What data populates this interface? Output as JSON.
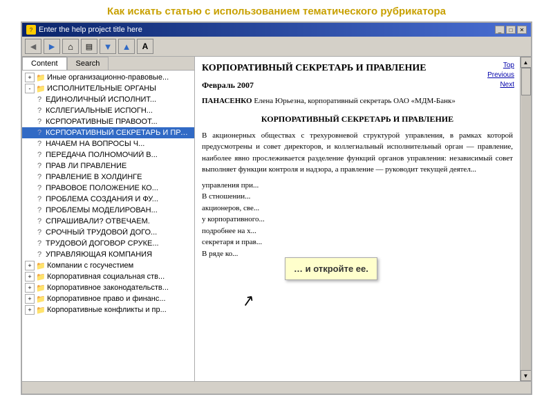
{
  "page": {
    "title": "Как искать статью с использованием тематического рубрикатора"
  },
  "window": {
    "title": "Enter the help project title here",
    "controls": {
      "minimize": "_",
      "maximize": "□",
      "close": "✕"
    }
  },
  "toolbar": {
    "back": "◄",
    "forward": "►",
    "home": "⌂",
    "print": "🖨",
    "down": "▼",
    "up": "▲",
    "font": "A"
  },
  "tabs": {
    "content": "Content",
    "search": "Search"
  },
  "tree": {
    "items": [
      {
        "id": "t1",
        "level": 1,
        "toggle": "+",
        "icon": "folder",
        "label": "Иные организационно-правовые...",
        "color": "#c04040"
      },
      {
        "id": "t2",
        "level": 1,
        "toggle": "-",
        "icon": "folder",
        "label": "ИСПОЛНИТЕЛЬНЫЕ ОРГАНЫ",
        "color": "#c04040"
      },
      {
        "id": "t3",
        "level": 2,
        "toggle": null,
        "icon": "doc",
        "label": "ЕДИНОЛИЧНЫЙ ИСПОЛНИТ..."
      },
      {
        "id": "t4",
        "level": 2,
        "toggle": null,
        "icon": "doc",
        "label": "КСЛЛЕГИАЛЬНЫЕ ИСПОГН..."
      },
      {
        "id": "t5",
        "level": 2,
        "toggle": null,
        "icon": "doc",
        "label": "КСРПОРАТИВНЫЕ ПРАВООТ..."
      },
      {
        "id": "t6",
        "level": 2,
        "toggle": null,
        "icon": "doc",
        "label": "КСРПОРАТИВНЫЙ СЕКРЕТАРЬ И ПРАВЛЕНИЕ",
        "highlighted": true
      },
      {
        "id": "t7",
        "level": 2,
        "toggle": null,
        "icon": "doc",
        "label": "НАЧАЕМ НА ВОПРОСЫ Ч..."
      },
      {
        "id": "t8",
        "level": 2,
        "toggle": null,
        "icon": "doc",
        "label": "ПЕРЕДАЧА ПОЛНОМОЧИЙ В..."
      },
      {
        "id": "t9",
        "level": 2,
        "toggle": null,
        "icon": "doc",
        "label": "ПРАВ ЛИ ПРАВЛЕНИЕ"
      },
      {
        "id": "t10",
        "level": 2,
        "toggle": null,
        "icon": "doc",
        "label": "ПРАВЛЕНИЕ В ХОЛДИНГЕ"
      },
      {
        "id": "t11",
        "level": 2,
        "toggle": null,
        "icon": "doc",
        "label": "ПРАВОВОЕ ПОЛОЖЕНИЕ КО..."
      },
      {
        "id": "t12",
        "level": 2,
        "toggle": null,
        "icon": "doc",
        "label": "ПРОБЛЕМА СОЗДАНИЯ И ФУ..."
      },
      {
        "id": "t13",
        "level": 2,
        "toggle": null,
        "icon": "doc",
        "label": "ПРОБЛЕМЫ МОДЕЛИРОВАН..."
      },
      {
        "id": "t14",
        "level": 2,
        "toggle": null,
        "icon": "doc",
        "label": "СПРАШИВАЛИ? ОТВЕЧАЕМ."
      },
      {
        "id": "t15",
        "level": 2,
        "toggle": null,
        "icon": "doc",
        "label": "СРОЧНЫЙ ТРУДОВОЙ ДОГО..."
      },
      {
        "id": "t16",
        "level": 2,
        "toggle": null,
        "icon": "doc",
        "label": "ТРУДОВОЙ ДОГОВОР СРУКЕ..."
      },
      {
        "id": "t17",
        "level": 2,
        "toggle": null,
        "icon": "doc",
        "label": "УПРАВЛЯЮЩАЯ КОМПАНИЯ"
      },
      {
        "id": "t18",
        "level": 1,
        "toggle": "+",
        "icon": "folder",
        "label": "Компании с госучестием",
        "color": "#c04040"
      },
      {
        "id": "t19",
        "level": 1,
        "toggle": "+",
        "icon": "folder",
        "label": "Корпоративная социальная ств...",
        "color": "#c04040"
      },
      {
        "id": "t20",
        "level": 1,
        "toggle": "+",
        "icon": "folder",
        "label": "Корпоративное законодательств...",
        "color": "#c04040"
      },
      {
        "id": "t21",
        "level": 1,
        "toggle": "+",
        "icon": "folder",
        "label": "Корпоративное право и финанс...",
        "color": "#c04040"
      },
      {
        "id": "t22",
        "level": 1,
        "toggle": "+",
        "icon": "folder",
        "label": "Корпоративные конфликты и пр...",
        "color": "#c04040"
      }
    ]
  },
  "article": {
    "title": "КОРПОРАТИВНЫЙ СЕКРЕТАРЬ И ПРАВЛЕНИЕ",
    "nav": {
      "top": "Top",
      "previous": "Previous",
      "next": "Next"
    },
    "date": "Февраль 2007",
    "author_surname": "ПАНАСЕНКО",
    "author_name": "Елена Юрьезна,",
    "author_role": "корпоративный секретарь ОАО «МДМ-Банк»",
    "subtitle": "КОРПОРАТИВНЫЙ СЕКРЕТАРЬ И ПРАВЛЕНИЕ",
    "body1": "В акционерных обществах с трехуровневой структурой управления, в рамках которой предусмотрены и совет директоров, и коллегиальный исполнительный орган — правление, наиболее явно прослеживается разделение функций органов управления: независимый совет выполняет функции контроля и надзора, а правление — руководит текущей деятел...",
    "body2": "управления при...",
    "body3": "В стношении...",
    "body4": "акционеров, све...",
    "body5": "у корпоративного...",
    "body6": "подробнее на х...",
    "body7": "секретаря и прав...",
    "body8": "В ряде ко..."
  },
  "tooltip": {
    "text": "… и откройте ее."
  },
  "statusbar": {
    "text": ""
  }
}
